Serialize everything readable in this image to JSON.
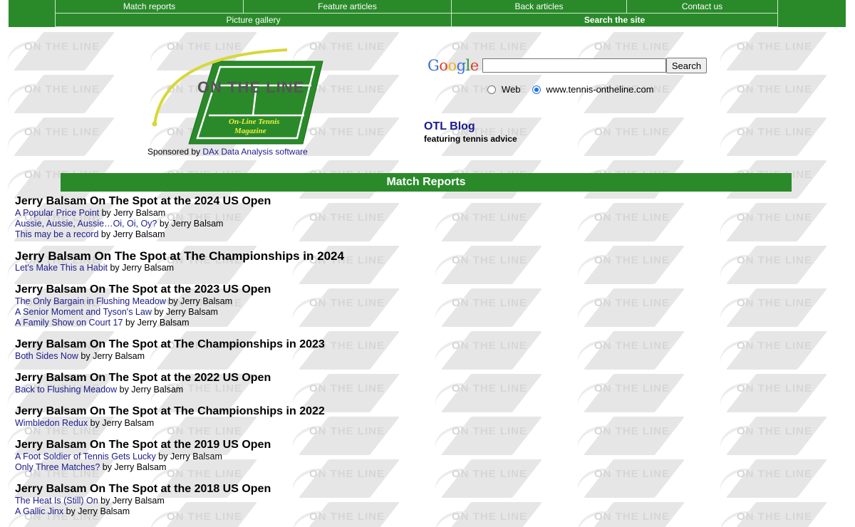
{
  "nav": {
    "row1": [
      "Match reports",
      "Feature articles",
      "Back articles",
      "Contact us"
    ],
    "row2": [
      "Picture gallery",
      "Search the site"
    ]
  },
  "logo": {
    "title": "ON THE LINE",
    "subtitle1": "On-Line Tennis",
    "subtitle2": "Magazine"
  },
  "sponsor": {
    "prefix": "Sponsored by ",
    "link": "DAx Data Analysis software"
  },
  "search": {
    "brand": "Google",
    "value": "",
    "button": "Search",
    "option_web": "Web",
    "option_site": "www.tennis-ontheline.com"
  },
  "blog": {
    "title": "OTL Blog",
    "subtitle": "featuring tennis advice"
  },
  "section_title": "Match Reports",
  "watermark_text": "ON THE LINE",
  "groups": [
    {
      "title": "Jerry Balsam On The Spot at the 2024 US Open",
      "articles": [
        {
          "title": "A Popular Price Point",
          "by": " by Jerry Balsam"
        },
        {
          "title": "Aussie, Aussie, Aussie…Oi, Oi, Oy?",
          "by": " by Jerry Balsam"
        },
        {
          "title": "This may be a record",
          "by": " by Jerry Balsam"
        }
      ]
    },
    {
      "title": "Jerry Balsam On The Spot at The Championships in 2024",
      "articles": [
        {
          "title": "Let's Make This a Habit",
          "by": " by Jerry Balsam"
        }
      ]
    },
    {
      "title": "Jerry Balsam On The Spot at the 2023 US Open",
      "articles": [
        {
          "title": "The Only Bargain in Flushing Meadow",
          "by": " by Jerry Balsam"
        },
        {
          "title": "A Senior Moment and Tyson's Law",
          "by": " by Jerry Balsam"
        },
        {
          "title": "A Family Show on Court 17",
          "by": " by Jerry Balsam"
        }
      ]
    },
    {
      "title": "Jerry Balsam On The Spot at The Championships in 2023",
      "articles": [
        {
          "title": "Both Sides Now",
          "by": " by Jerry Balsam"
        }
      ]
    },
    {
      "title": "Jerry Balsam On The Spot at the 2022 US Open",
      "articles": [
        {
          "title": "Back to Flushing Meadow",
          "by": " by Jerry Balsam"
        }
      ]
    },
    {
      "title": "Jerry Balsam On The Spot at The Championships in 2022",
      "articles": [
        {
          "title": "Wimbledon Redux",
          "by": " by Jerry Balsam"
        }
      ]
    },
    {
      "title": "Jerry Balsam On The Spot at the 2019 US Open",
      "articles": [
        {
          "title": "A Foot Soldier of Tennis Gets Lucky",
          "by": " by Jerry Balsam"
        },
        {
          "title": "Only Three Matches?",
          "by": " by Jerry Balsam"
        }
      ]
    },
    {
      "title": "Jerry Balsam On The Spot at the 2018 US Open",
      "articles": [
        {
          "title": "The Heat Is (Still) On",
          "by": " by Jerry Balsam"
        },
        {
          "title": "A Gallic Jinx",
          "by": " by Jerry Balsam"
        }
      ]
    }
  ],
  "colors": {
    "nav_green": "#2a8a2a",
    "link": "#1a1a8c"
  }
}
